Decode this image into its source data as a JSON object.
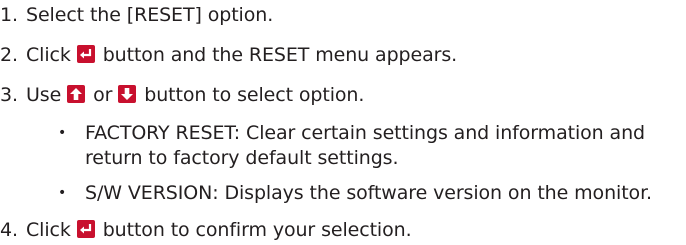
{
  "steps": [
    {
      "num": "1.",
      "text": "Select the [RESET] option."
    },
    {
      "num": "2.",
      "pre": "Click",
      "post": "button and the RESET menu appears."
    },
    {
      "num": "3.",
      "pre": "Use",
      "mid": "or",
      "post": "button to select option."
    },
    {
      "num": "4.",
      "pre": "Click",
      "post": "button to confirm your selection."
    }
  ],
  "bullets": [
    {
      "dot": "•",
      "line1": "FACTORY RESET: Clear certain settings and information and",
      "line2": "return to factory default settings."
    },
    {
      "dot": "•",
      "line1": "S/W VERSION: Displays the software version on the monitor."
    }
  ],
  "icons": {
    "enter": "enter-button-icon",
    "up": "up-arrow-button-icon",
    "down": "down-arrow-button-icon",
    "color": "#c8102e"
  }
}
